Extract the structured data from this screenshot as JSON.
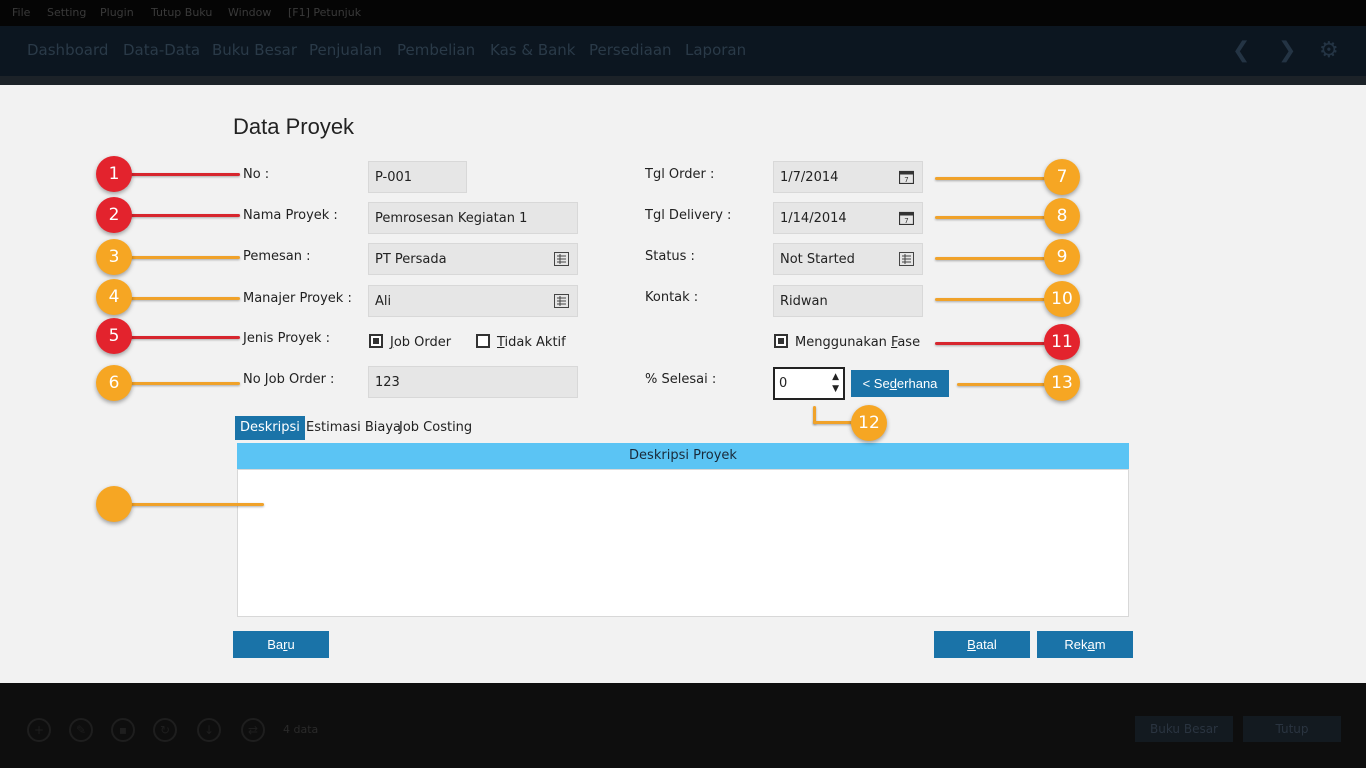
{
  "menu": [
    "File",
    "Setting",
    "Plugin",
    "Tutup Buku",
    "Window",
    "[F1] Petunjuk"
  ],
  "nav": [
    "Dashboard",
    "Data-Data",
    "Buku Besar",
    "Penjualan",
    "Pembelian",
    "Kas & Bank",
    "Persediaan",
    "Laporan"
  ],
  "nav_icons": [
    "chevron-left-icon",
    "chevron-right-icon",
    "gear-icon"
  ],
  "form": {
    "title": "Data Proyek",
    "no": {
      "label": "No :",
      "value": "P-001"
    },
    "nama_proyek": {
      "label": "Nama Proyek :",
      "value": "Pemrosesan Kegiatan 1"
    },
    "pemesan": {
      "label": "Pemesan :",
      "value": "PT Persada"
    },
    "manajer": {
      "label": "Manajer Proyek :",
      "value": "Ali"
    },
    "jenis": {
      "label": "Jenis Proyek :",
      "job_order_pre": "J",
      "job_order_rest": "ob Order",
      "tidak_pre": "T",
      "tidak_rest": "idak Aktif"
    },
    "no_job_order": {
      "label": "No Job Order :",
      "value": "123"
    },
    "tgl_order": {
      "label": "Tgl Order :",
      "value": "1/7/2014"
    },
    "tgl_delivery": {
      "label": "Tgl Delivery :",
      "value": "1/14/2014"
    },
    "status": {
      "label": "Status :",
      "value": "Not Started"
    },
    "kontak": {
      "label": "Kontak :",
      "value": "Ridwan"
    },
    "fase": {
      "pre": "Menggunakan ",
      "u": "F",
      "rest": "ase"
    },
    "selesai": {
      "label": "% Selesai :",
      "value": "0"
    },
    "sederhana": {
      "pre": "< Se",
      "u": "d",
      "rest": "erhana"
    }
  },
  "tabs": [
    "Deskripsi",
    "Estimasi Biaya",
    "Job Costing"
  ],
  "panel_title": "Deskripsi Proyek",
  "buttons": {
    "baru": {
      "pre": "Ba",
      "u": "r",
      "rest": "u"
    },
    "batal": {
      "u": "B",
      "rest": "atal"
    },
    "rekam": {
      "pre": "Rek",
      "u": "a",
      "rest": "m"
    }
  },
  "footer": {
    "count": "4 data",
    "buku_besar": "Buku Besar",
    "tutup": "Tutup"
  },
  "badges": [
    "1",
    "2",
    "3",
    "4",
    "5",
    "6",
    "7",
    "8",
    "9",
    "10",
    "11",
    "12",
    "13"
  ],
  "colors": {
    "accent": "#1a73a8",
    "panel_header": "#5bc4f4",
    "badge_red": "#e3232d",
    "badge_orange": "#f6a623"
  }
}
